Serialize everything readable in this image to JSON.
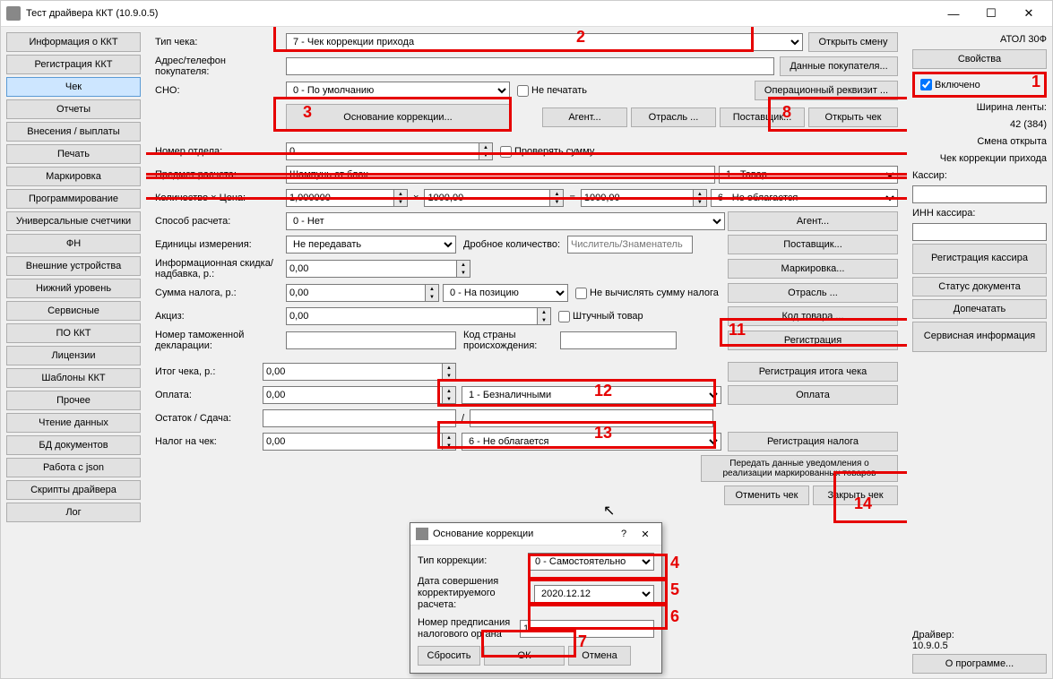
{
  "title": "Тест драйвера ККТ (10.9.0.5)",
  "left_nav": {
    "info": "Информация о ККТ",
    "reg": "Регистрация ККТ",
    "chek": "Чек",
    "reports": "Отчеты",
    "deposit": "Внесения / выплаты",
    "print": "Печать",
    "marking": "Маркировка",
    "prog": "Программирование",
    "counters": "Универсальные счетчики",
    "fn": "ФН",
    "ext": "Внешние устройства",
    "low": "Нижний уровень",
    "service": "Сервисные",
    "pokkt": "ПО ККТ",
    "lic": "Лицензии",
    "tmpl": "Шаблоны ККТ",
    "other": "Прочее",
    "read": "Чтение данных",
    "bd": "БД документов",
    "json": "Работа с json",
    "scripts": "Скрипты драйвера",
    "log": "Лог"
  },
  "labels": {
    "tip_cheka": "Тип чека:",
    "adres": "Адрес/телефон покупателя:",
    "sno": "СНО:",
    "nomer_otdela": "Номер отдела:",
    "predmet": "Предмет расчета:",
    "kolvo": "Количество × Цена:",
    "sposob": "Способ расчета:",
    "edinitsy": "Единицы измерения:",
    "drob": "Дробное количество:",
    "info_skidka": "Информационная скидка/надбавка, р.:",
    "sum_naloga": "Сумма налога, р.:",
    "aktsiz": "Акциз:",
    "nomer_tam": "Номер таможенной декларации:",
    "kod_strany": "Код страны происхождения:",
    "itog": "Итог чека, р.:",
    "oplata": "Оплата:",
    "ostatok": "Остаток / Сдача:",
    "nalog_chek": "Налог на чек:"
  },
  "values": {
    "tip_cheka": "7 - Чек коррекции прихода",
    "sno": "0 - По умолчанию",
    "ne_pechatat": "Не печатать",
    "nomer_otdela": "0",
    "prov_summu": "Проверять сумму",
    "predmet": "Шампунь от блох",
    "predmet_type": "1 - Товар",
    "kolvo": "1,000000",
    "tsena": "1000,00",
    "summa": "1000,00",
    "nalog_stavka": "6 - Не облагается",
    "sposob": "0 - Нет",
    "edinitsy": "Не передавать",
    "drob_ph": "Числитель/Знаменатель",
    "info_skidka": "0,00",
    "sum_naloga": "0,00",
    "nalog_type": "0 - На позицию",
    "ne_vych": "Не вычислять сумму налога",
    "aktsiz": "0,00",
    "shtuch": "Штучный товар",
    "itog": "0,00",
    "oplata": "0,00",
    "oplata_type": "1 - Безналичными",
    "nalog_chek_v": "0,00",
    "nalog_chek_type": "6 - Не облагается",
    "x": "×",
    "eq": "=",
    "slash": "/"
  },
  "buttons": {
    "open_shift": "Открыть смену",
    "buyer_data": "Данные покупателя...",
    "op_rekvizit": "Операционный реквизит ...",
    "osnov": "Основание коррекции...",
    "agent": "Агент...",
    "otrasl": "Отрасль ...",
    "postavshik": "Поставщик...",
    "open_check": "Открыть чек",
    "agent2": "Агент...",
    "postavshik2": "Поставщик...",
    "marking": "Маркировка...",
    "otrasl2": "Отрасль ...",
    "kod_tovara": "Код товара ...",
    "reg": "Регистрация",
    "reg_itog": "Регистрация итога чека",
    "oplata_btn": "Оплата",
    "reg_nalog": "Регистрация налога",
    "peredat": "Передать данные уведомления о реализации маркированных товаров",
    "cancel_check": "Отменить чек",
    "close_check": "Закрыть чек"
  },
  "right": {
    "model": "АТОЛ 30Ф",
    "props": "Свойства",
    "enabled": "Включено",
    "tape_lbl": "Ширина ленты:",
    "tape_val": "42 (384)",
    "shift": "Смена открыта",
    "chek_state": "Чек коррекции прихода",
    "kassir_lbl": "Кассир:",
    "inn_lbl": "ИНН кассира:",
    "reg_kassir": "Регистрация кассира",
    "status": "Статус документа",
    "dopechat": "Допечатать",
    "service_info": "Сервисная информация",
    "driver_lbl": "Драйвер:",
    "driver_ver": "10.9.0.5",
    "about": "О программе..."
  },
  "modal": {
    "title": "Основание коррекции",
    "tip_lbl": "Тип коррекции:",
    "tip_val": "0 - Самостоятельно",
    "date_lbl": "Дата совершения корректируемого расчета:",
    "date_val": "2020.12.12",
    "num_lbl": "Номер предписания налогового органа",
    "num_val": "1",
    "reset": "Сбросить",
    "ok": "ОК",
    "cancel": "Отмена"
  }
}
